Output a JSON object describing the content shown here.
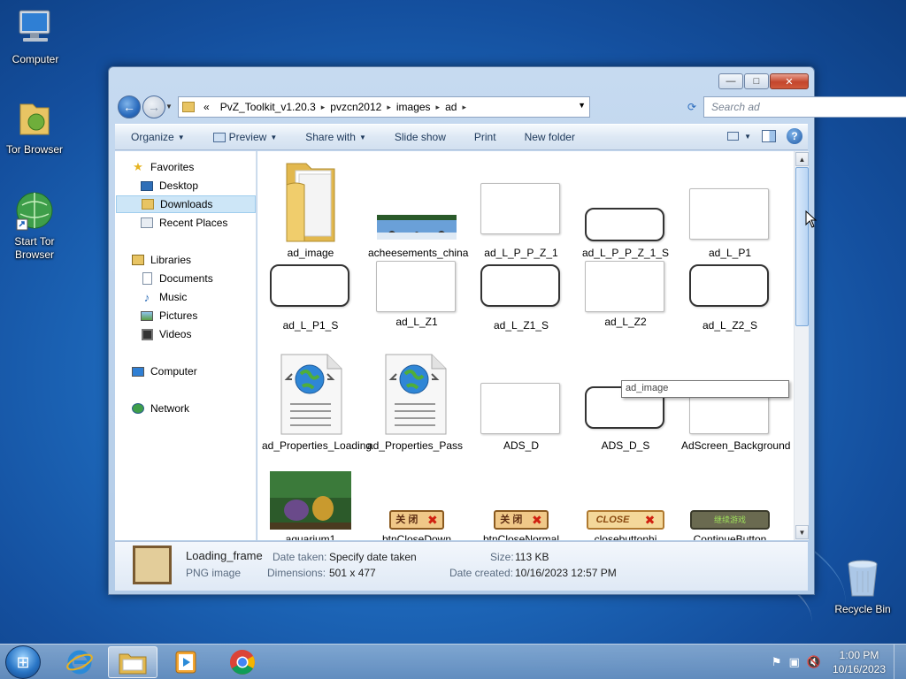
{
  "desktop": {
    "icons": [
      {
        "label": "Computer",
        "icon": "computer-icon"
      },
      {
        "label": "Tor Browser",
        "icon": "folder-icon"
      },
      {
        "label": "Start Tor Browser",
        "icon": "globe-icon"
      },
      {
        "label": "Recycle Bin",
        "icon": "recycle-bin-icon"
      }
    ]
  },
  "window": {
    "controls": {
      "minimize": "—",
      "maximize": "□",
      "close": "✕"
    },
    "address": {
      "overflow": "«",
      "segments": [
        "PvZ_Toolkit_v1.20.3",
        "pvzcn2012",
        "images",
        "ad"
      ]
    },
    "search": {
      "placeholder": "Search ad"
    },
    "toolbar": {
      "organize": "Organize",
      "preview": "Preview",
      "share_with": "Share with",
      "slide_show": "Slide show",
      "print": "Print",
      "new_folder": "New folder",
      "help": "?"
    },
    "nav_pane": {
      "favorites": "Favorites",
      "desktop": "Desktop",
      "downloads": "Downloads",
      "recent_places": "Recent Places",
      "libraries": "Libraries",
      "documents": "Documents",
      "music": "Music",
      "pictures": "Pictures",
      "videos": "Videos",
      "computer": "Computer",
      "network": "Network"
    },
    "files": [
      {
        "name": "ad_image",
        "kind": "folder"
      },
      {
        "name": "acheesements_china",
        "kind": "photo-strip"
      },
      {
        "name": "ad_L_P_P_Z_1",
        "kind": "bubble-light"
      },
      {
        "name": "ad_L_P_P_Z_1_S",
        "kind": "bubble-dark"
      },
      {
        "name": "ad_L_P1",
        "kind": "bubble-light"
      },
      {
        "name": "ad_L_P1_S",
        "kind": "bubble-dark"
      },
      {
        "name": "ad_L_Z1",
        "kind": "bubble-light"
      },
      {
        "name": "ad_L_Z1_S",
        "kind": "bubble-dark"
      },
      {
        "name": "ad_L_Z2",
        "kind": "bubble-light"
      },
      {
        "name": "ad_L_Z2_S",
        "kind": "bubble-dark"
      },
      {
        "name": "ad_Properties_Loading",
        "kind": "xml-doc"
      },
      {
        "name": "ad_Properties_Pass",
        "kind": "xml-doc"
      },
      {
        "name": "ADS_D",
        "kind": "bubble-light"
      },
      {
        "name": "ADS_D_S",
        "kind": "bubble-dark"
      },
      {
        "name": "AdScreen_Background",
        "kind": "bubble-light"
      },
      {
        "name": "aquarium1",
        "kind": "aquarium"
      },
      {
        "name": "btnCloseDown",
        "kind": "btn-close-cn",
        "button_text": "关 闭"
      },
      {
        "name": "btnCloseNormal",
        "kind": "btn-close-cn",
        "button_text": "关 闭"
      },
      {
        "name": "closebuttonhi",
        "kind": "btn-close-en",
        "button_text": "CLOSE"
      },
      {
        "name": "ContinueButton",
        "kind": "btn-continue",
        "button_text": "继续游戏"
      }
    ],
    "tooltip": "ad_image",
    "details": {
      "name": "Loading_frame",
      "type": "PNG image",
      "date_taken_label": "Date taken:",
      "date_taken": "Specify date taken",
      "dimensions_label": "Dimensions:",
      "dimensions": "501 x 477",
      "size_label": "Size:",
      "size": "113 KB",
      "date_created_label": "Date created:",
      "date_created": "10/16/2023 12:57 PM"
    }
  },
  "taskbar": {
    "apps": [
      "internet-explorer-icon",
      "file-explorer-icon",
      "media-player-icon",
      "chrome-icon"
    ],
    "clock": {
      "time": "1:00 PM",
      "date": "10/16/2023"
    }
  }
}
